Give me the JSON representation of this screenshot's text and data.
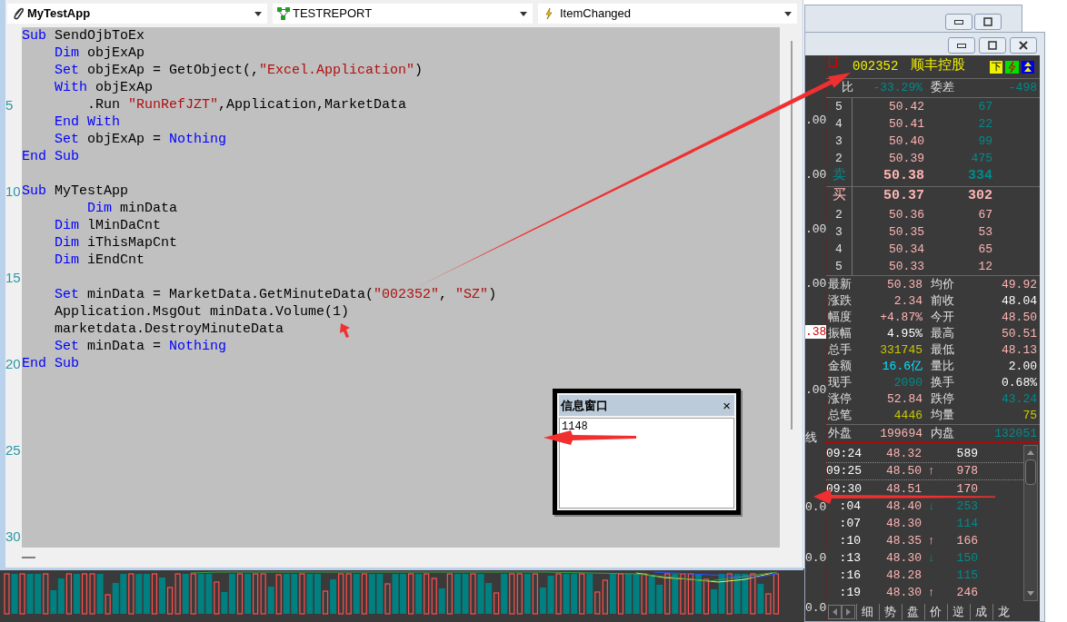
{
  "editor": {
    "object_dropdown": "MyTestApp",
    "module_dropdown": "TESTREPORT",
    "event_dropdown": "ItemChanged",
    "lines": [
      {
        "kind": "code",
        "tokens": [
          {
            "kind": "keyword",
            "text": "Sub"
          },
          {
            "kind": "plain",
            "text": " SendOjbToEx"
          }
        ]
      },
      {
        "kind": "code",
        "tokens": [
          {
            "kind": "keyword",
            "text": "    Dim"
          },
          {
            "kind": "plain",
            "text": " objExAp"
          }
        ]
      },
      {
        "kind": "code",
        "tokens": [
          {
            "kind": "keyword",
            "text": "    Set"
          },
          {
            "kind": "plain",
            "text": " objExAp = GetObject(,"
          },
          {
            "kind": "string",
            "text": "\"Excel.Application\""
          },
          {
            "kind": "plain",
            "text": ")"
          }
        ]
      },
      {
        "kind": "code",
        "tokens": [
          {
            "kind": "keyword",
            "text": "    With"
          },
          {
            "kind": "plain",
            "text": " objExAp"
          }
        ]
      },
      {
        "kind": "code",
        "number": "5",
        "tokens": [
          {
            "kind": "plain",
            "text": "        .Run "
          },
          {
            "kind": "string",
            "text": "\"RunRefJZT\""
          },
          {
            "kind": "plain",
            "text": ",Application,MarketData"
          }
        ]
      },
      {
        "kind": "code",
        "tokens": [
          {
            "kind": "keyword",
            "text": "    End With"
          }
        ]
      },
      {
        "kind": "code",
        "tokens": [
          {
            "kind": "keyword",
            "text": "    Set"
          },
          {
            "kind": "plain",
            "text": " objExAp = "
          },
          {
            "kind": "keyword",
            "text": "Nothing"
          }
        ]
      },
      {
        "kind": "code",
        "tokens": [
          {
            "kind": "keyword",
            "text": "End Sub"
          }
        ]
      },
      {
        "kind": "blank"
      },
      {
        "kind": "code",
        "number": "10",
        "tokens": [
          {
            "kind": "keyword",
            "text": "Sub"
          },
          {
            "kind": "plain",
            "text": " MyTestApp"
          }
        ]
      },
      {
        "kind": "code",
        "tokens": [
          {
            "kind": "keyword",
            "text": "        Dim"
          },
          {
            "kind": "plain",
            "text": " minData"
          }
        ]
      },
      {
        "kind": "code",
        "tokens": [
          {
            "kind": "keyword",
            "text": "    Dim"
          },
          {
            "kind": "plain",
            "text": " lMinDaCnt"
          }
        ]
      },
      {
        "kind": "code",
        "tokens": [
          {
            "kind": "keyword",
            "text": "    Dim"
          },
          {
            "kind": "plain",
            "text": " iThisMapCnt"
          }
        ]
      },
      {
        "kind": "code",
        "tokens": [
          {
            "kind": "keyword",
            "text": "    Dim"
          },
          {
            "kind": "plain",
            "text": " iEndCnt"
          }
        ]
      },
      {
        "kind": "blank",
        "number": "15"
      },
      {
        "kind": "code",
        "tokens": [
          {
            "kind": "keyword",
            "text": "    Set"
          },
          {
            "kind": "plain",
            "text": " minData = MarketData.GetMinuteData("
          },
          {
            "kind": "string",
            "text": "\"002352\""
          },
          {
            "kind": "plain",
            "text": ", "
          },
          {
            "kind": "string",
            "text": "\"SZ\""
          },
          {
            "kind": "plain",
            "text": ")"
          }
        ]
      },
      {
        "kind": "code",
        "tokens": [
          {
            "kind": "plain",
            "text": "    Application.MsgOut minData.Volume(1)"
          }
        ]
      },
      {
        "kind": "code",
        "tokens": [
          {
            "kind": "plain",
            "text": "    marketdata.DestroyMinuteData"
          }
        ]
      },
      {
        "kind": "code",
        "tokens": [
          {
            "kind": "keyword",
            "text": "    Set"
          },
          {
            "kind": "plain",
            "text": " minData = "
          },
          {
            "kind": "keyword",
            "text": "Nothing"
          }
        ]
      },
      {
        "kind": "code",
        "number": "20",
        "tokens": [
          {
            "kind": "keyword",
            "text": "End Sub"
          }
        ]
      },
      {
        "kind": "blank"
      },
      {
        "kind": "blank"
      },
      {
        "kind": "blank"
      },
      {
        "kind": "blank"
      },
      {
        "kind": "blank",
        "number": "25"
      },
      {
        "kind": "blank"
      },
      {
        "kind": "blank"
      },
      {
        "kind": "blank"
      },
      {
        "kind": "blank"
      },
      {
        "kind": "blank",
        "number": "30"
      }
    ]
  },
  "info_window": {
    "title": "信息窗口",
    "close": "×",
    "output": "1148"
  },
  "axis_labels": [
    ".00",
    ".00",
    ".00",
    ".00",
    ".38",
    ".00",
    "线",
    "0.0",
    "0.0",
    "0.0"
  ],
  "quote": {
    "code": "002352",
    "name": "顺丰控股",
    "badge": "下",
    "ratio": {
      "left": {
        "label": "比",
        "value": "-33.29%",
        "color": "#008b8b"
      },
      "right": {
        "label": "委差",
        "value": "-498",
        "color": "#008b8b"
      }
    },
    "asks": [
      {
        "level": "5",
        "price": "50.42",
        "volume": "67",
        "kind": "level",
        "color": "#008b8b"
      },
      {
        "level": "4",
        "price": "50.41",
        "volume": "22",
        "kind": "level",
        "color": "#008b8b"
      },
      {
        "level": "3",
        "price": "50.40",
        "volume": "99",
        "kind": "level",
        "color": "#008b8b"
      },
      {
        "level": "2",
        "price": "50.39",
        "volume": "475",
        "kind": "level",
        "color": "#008b8b"
      },
      {
        "level": "卖",
        "price": "50.38",
        "volume": "334",
        "kind": "best",
        "color": "#008b8b"
      }
    ],
    "bids": [
      {
        "level": "买",
        "price": "50.37",
        "volume": "302",
        "kind": "best",
        "color": "#ffb4b4"
      },
      {
        "level": "2",
        "price": "50.36",
        "volume": "67",
        "kind": "level",
        "color": "#ffb4b4"
      },
      {
        "level": "3",
        "price": "50.35",
        "volume": "53",
        "kind": "level",
        "color": "#ffb4b4"
      },
      {
        "level": "4",
        "price": "50.34",
        "volume": "65",
        "kind": "level",
        "color": "#ffb4b4"
      },
      {
        "level": "5",
        "price": "50.33",
        "volume": "12",
        "kind": "level",
        "color": "#ffb4b4"
      }
    ],
    "stats": [
      {
        "left": {
          "label": "最新",
          "value": "50.38",
          "color": "#ffb4b4"
        },
        "right": {
          "label": "均价",
          "value": "49.92",
          "color": "#ffb4b4"
        }
      },
      {
        "left": {
          "label": "涨跌",
          "value": "2.34",
          "color": "#ffb4b4"
        },
        "right": {
          "label": "前收",
          "value": "48.04",
          "color": "#ffffff"
        }
      },
      {
        "left": {
          "label": "幅度",
          "value": "+4.87%",
          "color": "#ffb4b4"
        },
        "right": {
          "label": "今开",
          "value": "48.50",
          "color": "#ffb4b4"
        }
      },
      {
        "left": {
          "label": "振幅",
          "value": "4.95%",
          "color": "#ffffff"
        },
        "right": {
          "label": "最高",
          "value": "50.51",
          "color": "#ffb4b4"
        }
      },
      {
        "left": {
          "label": "总手",
          "value": "331745",
          "color": "#c8c800"
        },
        "right": {
          "label": "最低",
          "value": "48.13",
          "color": "#ffb4b4"
        }
      },
      {
        "left": {
          "label": "金额",
          "value": "16.6亿",
          "color": "#00e5ff"
        },
        "right": {
          "label": "量比",
          "value": "2.00",
          "color": "#ffffff"
        }
      },
      {
        "left": {
          "label": "现手",
          "value": "2090",
          "color": "#008b8b"
        },
        "right": {
          "label": "换手",
          "value": "0.68%",
          "color": "#ffffff"
        }
      },
      {
        "left": {
          "label": "涨停",
          "value": "52.84",
          "color": "#ffb4b4"
        },
        "right": {
          "label": "跌停",
          "value": "43.24",
          "color": "#008b8b"
        }
      },
      {
        "left": {
          "label": "总笔",
          "value": "4446",
          "color": "#c8c800"
        },
        "right": {
          "label": "均量",
          "value": "75",
          "color": "#c8c800"
        }
      }
    ],
    "outer": {
      "left": {
        "label": "外盘",
        "value": "199694",
        "color": "#ffb4b4"
      },
      "right": {
        "label": "内盘",
        "value": "132051",
        "color": "#008b8b"
      }
    },
    "ticks": [
      {
        "time": "09:24",
        "price": "48.32",
        "volume": "589",
        "color": "#ffffff"
      },
      {
        "time": "09:25",
        "price": "48.50",
        "arrow": "↑",
        "volume": "978",
        "color": "#ffb4b4"
      },
      {
        "time": "09:30",
        "price": "48.51",
        "volume": "170",
        "color": "#ffb4b4"
      },
      {
        "time": ":04",
        "price": "48.40",
        "arrow": "↓",
        "volume": "253",
        "color": "#008b8b"
      },
      {
        "time": ":07",
        "price": "48.30",
        "volume": "114",
        "color": "#008b8b"
      },
      {
        "time": ":10",
        "price": "48.35",
        "arrow": "↑",
        "volume": "166",
        "color": "#ffb4b4"
      },
      {
        "time": ":13",
        "price": "48.30",
        "arrow": "↓",
        "volume": "150",
        "color": "#008b8b"
      },
      {
        "time": ":16",
        "price": "48.28",
        "volume": "115",
        "color": "#008b8b"
      },
      {
        "time": ":19",
        "price": "48.30",
        "arrow": "↑",
        "volume": "246",
        "color": "#ffb4b4"
      }
    ],
    "tabs": [
      {
        "label": "细",
        "selected": false
      },
      {
        "label": "势",
        "selected": false
      },
      {
        "label": "盘",
        "selected": false
      },
      {
        "label": "价",
        "selected": false
      },
      {
        "label": "逆",
        "selected": false
      },
      {
        "label": "成",
        "selected": false
      },
      {
        "label": "龙",
        "selected": false
      }
    ]
  }
}
